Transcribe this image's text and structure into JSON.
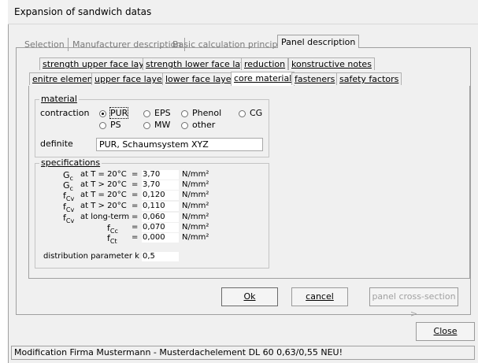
{
  "window": {
    "title": "Expansion of sandwich datas"
  },
  "top_tabs": [
    "Selection",
    "Manufacturer description",
    "Basic calculation principle",
    "Panel description"
  ],
  "sub_tabs_row1": [
    "strength upper face layer",
    "strength lower face layer",
    "reduction",
    "konstructive notes"
  ],
  "sub_tabs_row2": [
    "enitre element",
    "upper face layer",
    "lower face layer",
    "core material",
    "fasteners",
    "safety factors"
  ],
  "material": {
    "label": "material",
    "contraction_label": "contraction",
    "options": [
      "PUR",
      "EPS",
      "Phenol",
      "CG",
      "PS",
      "MW",
      "other"
    ],
    "selected": "PUR",
    "definite_label": "definite",
    "definite_value": "PUR, Schaumsystem XYZ"
  },
  "specifications": {
    "label": "specifications",
    "rows": [
      {
        "sym": "G",
        "sub": "c",
        "cond": "at T = 20°C",
        "eq": "=",
        "value": "3,70",
        "unit": "N/mm²"
      },
      {
        "sym": "G",
        "sub": "c",
        "cond": "at T > 20°C",
        "eq": "=",
        "value": "3,70",
        "unit": "N/mm²"
      },
      {
        "sym": "f",
        "sub": "Cv",
        "cond": "at T = 20°C",
        "eq": "=",
        "value": "0,120",
        "unit": "N/mm²"
      },
      {
        "sym": "f",
        "sub": "Cv",
        "cond": "at T > 20°C",
        "eq": "=",
        "value": "0,110",
        "unit": "N/mm²"
      },
      {
        "sym": "f",
        "sub": "Cv",
        "cond": "at long-term",
        "eq": "=",
        "value": "0,060",
        "unit": "N/mm²"
      },
      {
        "sym": "f",
        "sub": "Cc",
        "cond": "",
        "eq": "=",
        "value": "0,070",
        "unit": "N/mm²"
      },
      {
        "sym": "f",
        "sub": "Ct",
        "cond": "",
        "eq": "=",
        "value": "0,000",
        "unit": "N/mm²"
      }
    ],
    "distribution_label": "distribution parameter k =",
    "distribution_value": "0,5"
  },
  "buttons": {
    "ok": "Ok",
    "cancel": "cancel",
    "panel_cross_section": "panel cross-section >",
    "close": "Close"
  },
  "status_bar": "Modification Firma Mustermann - Musterdachelement DL 60 0,63/0,55 NEU!"
}
